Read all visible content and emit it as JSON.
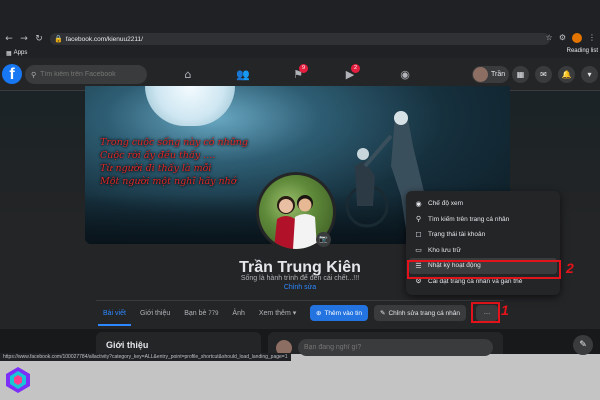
{
  "browser": {
    "url": "facebook.com/kienuu2211/",
    "bookmark_apps": "Apps",
    "bookmark_reading": "Reading list",
    "status_url": "https://www.facebook.com/100027784/allactivity?category_key=ALL&entry_point=profile_shortcut&should_load_landing_page=1"
  },
  "header": {
    "logo": "f",
    "search_placeholder": "Tìm kiếm trên Facebook",
    "groups_badge": "9",
    "video_badge": "2",
    "user_name": "Trần"
  },
  "cover": {
    "poem": "Trong cuộc sống này có những\nCuộc rời ấy đều thấy ....\nTừ người đi thấy là mỗi\nMột người một nghĩ hãy nhớ"
  },
  "profile": {
    "name": "Trần Trung Kiên",
    "bio": "Sống là hành trình để đến cái chết...!!!",
    "edit_bio": "Chỉnh sửa"
  },
  "tabs": [
    {
      "label": "Bài viết"
    },
    {
      "label": "Giới thiệu"
    },
    {
      "label": "Bạn bè",
      "count": "779"
    },
    {
      "label": "Ảnh"
    },
    {
      "label": "Xem thêm ▾"
    }
  ],
  "actions": {
    "add_story": "Thêm vào tin",
    "edit_profile": "Chỉnh sửa trang cá nhân",
    "more": "···"
  },
  "menu": {
    "items": [
      {
        "icon": "eye-icon",
        "label": "Chế độ xem"
      },
      {
        "icon": "search-icon",
        "label": "Tìm kiếm trên trang cá nhân"
      },
      {
        "icon": "user-status-icon",
        "label": "Trạng thái tài khoản"
      },
      {
        "icon": "archive-icon",
        "label": "Kho lưu trữ"
      },
      {
        "icon": "list-icon",
        "label": "Nhật ký hoạt động"
      },
      {
        "icon": "gear-icon",
        "label": "Cài đặt trang cá nhân và gắn thẻ"
      }
    ]
  },
  "annotations": {
    "step1": "1",
    "step2": "2",
    "highlight_color": "#e3131b"
  },
  "intro": {
    "title": "Giới thiệu"
  },
  "composer": {
    "placeholder": "Bạn đang nghĩ gì?"
  },
  "colors": {
    "fb_blue": "#1877f2",
    "accent": "#2d88ff",
    "surface": "#242526"
  }
}
